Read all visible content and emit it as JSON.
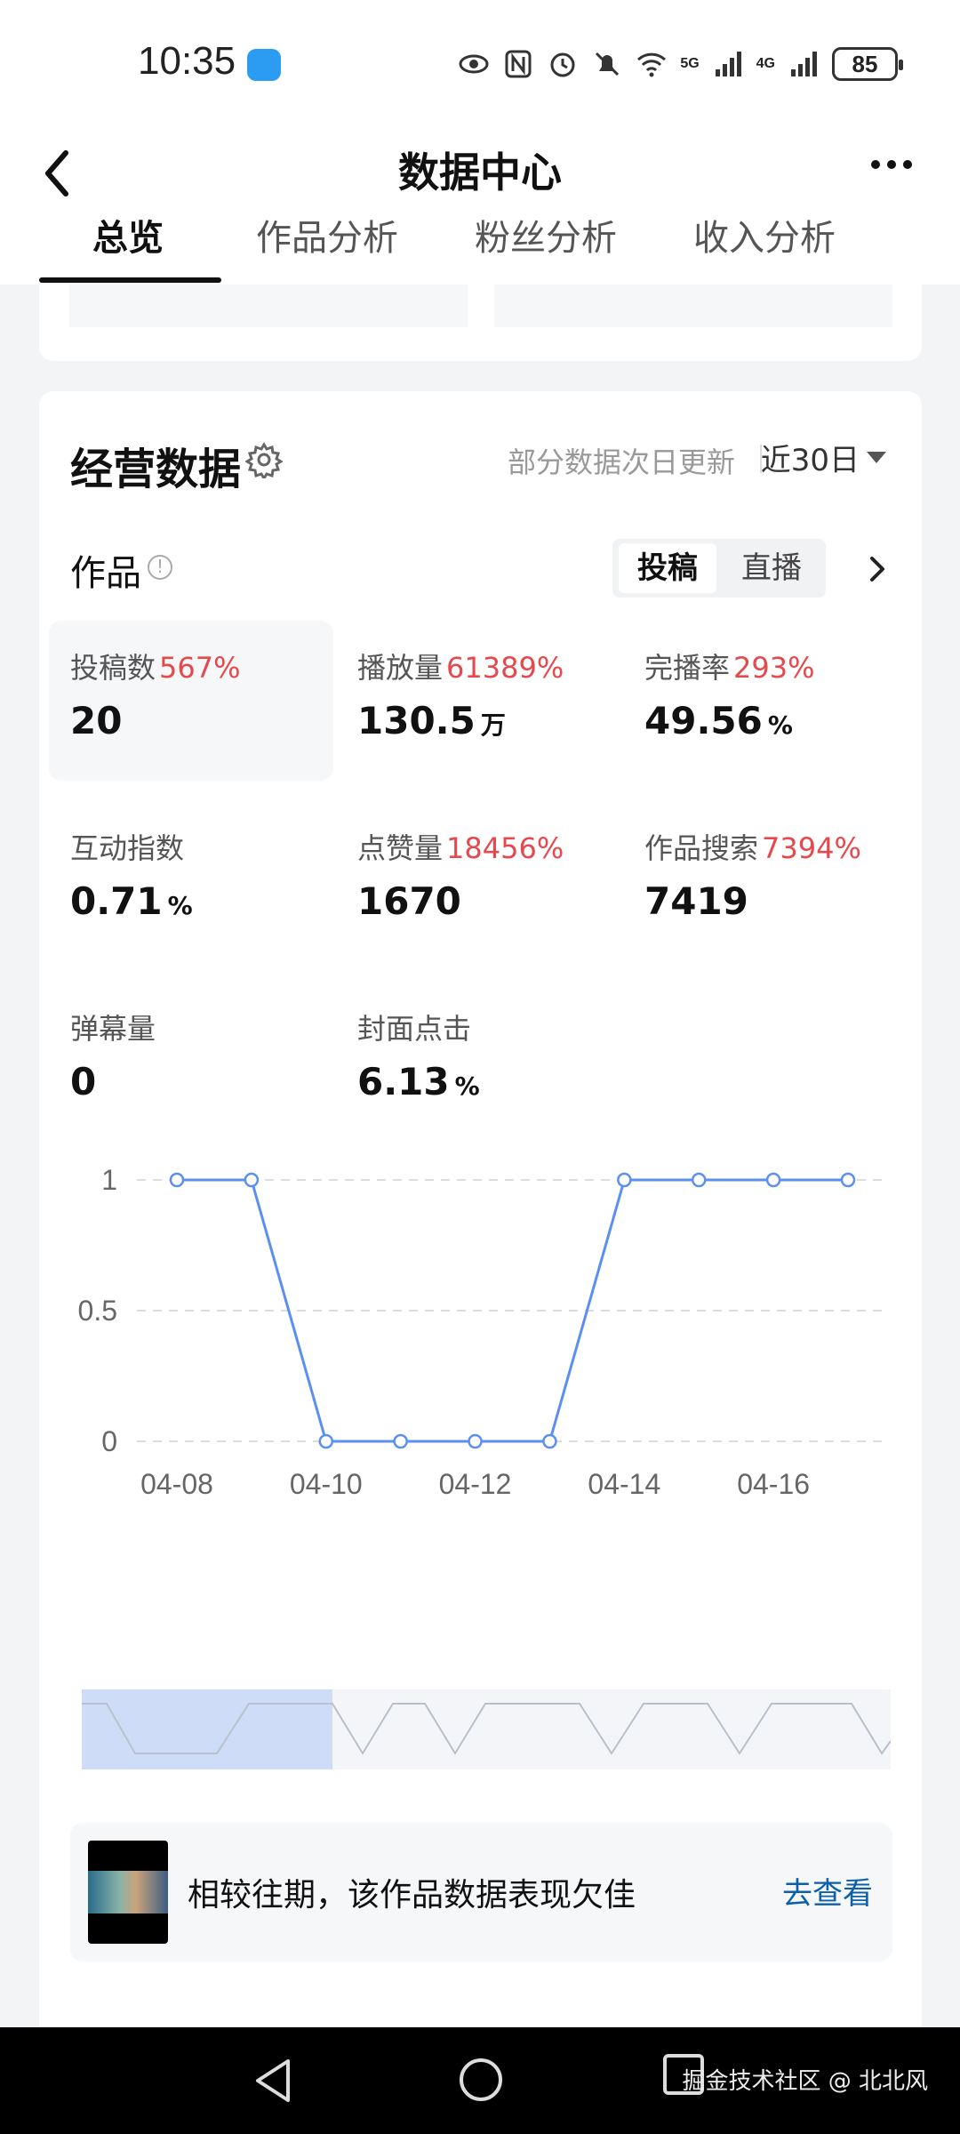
{
  "status_bar": {
    "time": "10:35",
    "signal_5g": "5G",
    "signal_4g": "4G",
    "battery": "85"
  },
  "header": {
    "title": "数据中心",
    "tabs": [
      "总览",
      "作品分析",
      "粉丝分析",
      "收入分析"
    ],
    "active_tab": 0
  },
  "section": {
    "title": "经营数据",
    "update_note": "部分数据次日更新",
    "range": "近30日"
  },
  "works": {
    "title": "作品",
    "info_symbol": "!",
    "segments": [
      "投稿",
      "直播"
    ],
    "active_segment": 0
  },
  "metrics": [
    {
      "label": "投稿数",
      "change": "567%",
      "value": "20",
      "unit": ""
    },
    {
      "label": "播放量",
      "change": "61389%",
      "value": "130.5",
      "unit": "万"
    },
    {
      "label": "完播率",
      "change": "293%",
      "value": "49.56",
      "unit": "%"
    },
    {
      "label": "互动指数",
      "change": "",
      "value": "0.71",
      "unit": "%"
    },
    {
      "label": "点赞量",
      "change": "18456%",
      "value": "1670",
      "unit": ""
    },
    {
      "label": "作品搜索",
      "change": "7394%",
      "value": "7419",
      "unit": ""
    },
    {
      "label": "弹幕量",
      "change": "",
      "value": "0",
      "unit": ""
    },
    {
      "label": "封面点击",
      "change": "",
      "value": "6.13",
      "unit": "%"
    }
  ],
  "chart_data": {
    "type": "line",
    "x": [
      "04-08",
      "04-09",
      "04-10",
      "04-11",
      "04-12",
      "04-13",
      "04-14",
      "04-15",
      "04-16",
      "04-17"
    ],
    "tick_labels": [
      "04-08",
      "04-10",
      "04-12",
      "04-14",
      "04-16"
    ],
    "series": [
      {
        "values": [
          1,
          1,
          0,
          0,
          0,
          0,
          1,
          1,
          1,
          1
        ]
      }
    ],
    "y_ticks": [
      "0",
      "0.5",
      "1"
    ],
    "ylim": [
      0,
      1
    ],
    "grid": true,
    "line_color": "#5b8ff0"
  },
  "tip": {
    "text": "相较往期，该作品数据表现欠佳",
    "link": "去查看"
  },
  "navbar": {
    "watermark": "掘金技术社区 @ 北北风"
  }
}
